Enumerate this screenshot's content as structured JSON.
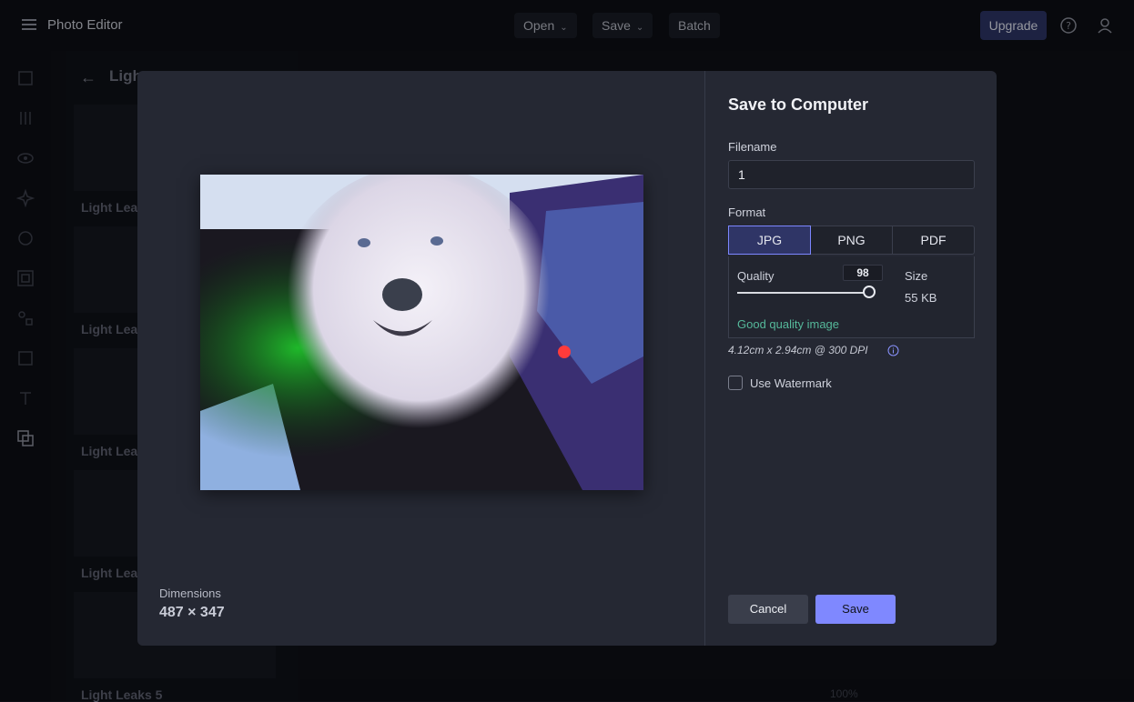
{
  "app": {
    "title": "Photo Editor"
  },
  "toolbar": {
    "open_label": "Open",
    "save_label": "Save",
    "batch_label": "Batch",
    "upgrade_label": "Upgrade"
  },
  "panel": {
    "title": "Ligh",
    "thumbnails": [
      "Light Leak",
      "Light Leak",
      "Light Leak",
      "Light Leak",
      "Light Leaks 5"
    ]
  },
  "bottom": {
    "zoom": "100%"
  },
  "dialog": {
    "title": "Save to Computer",
    "dimensions_label": "Dimensions",
    "dimensions_value": "487 × 347",
    "filename_label": "Filename",
    "filename_value": "1",
    "format_label": "Format",
    "formats": [
      "JPG",
      "PNG",
      "PDF"
    ],
    "selected_format": "JPG",
    "quality_label": "Quality",
    "quality_value": "98",
    "quality_fraction": 0.98,
    "size_label": "Size",
    "size_value": "55 KB",
    "quality_status": "Good quality image",
    "print_size": "4.12cm x 2.94cm @ 300 DPI",
    "watermark_label": "Use Watermark",
    "watermark_checked": false,
    "cancel_label": "Cancel",
    "save_label": "Save"
  },
  "colors": {
    "accent": "#7f88ff",
    "good": "#55b89a",
    "modal_bg": "#252833"
  }
}
